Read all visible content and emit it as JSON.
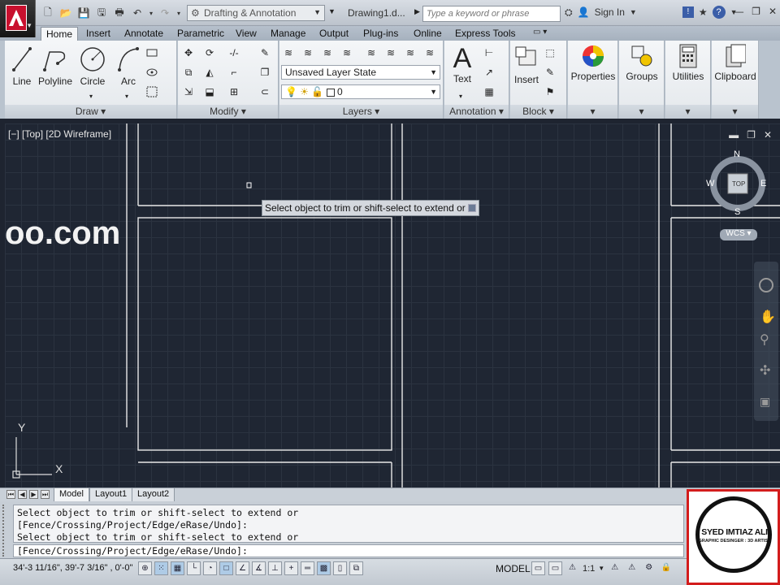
{
  "titlebar": {
    "workspace": "Drafting & Annotation",
    "document": "Drawing1.d...",
    "search_placeholder": "Type a keyword or phrase",
    "sign_in": "Sign In"
  },
  "tabs": [
    "Home",
    "Insert",
    "Annotate",
    "Parametric",
    "View",
    "Manage",
    "Output",
    "Plug-ins",
    "Online",
    "Express Tools"
  ],
  "ribbon": {
    "draw": {
      "title": "Draw",
      "tools": [
        "Line",
        "Polyline",
        "Circle",
        "Arc"
      ]
    },
    "modify": {
      "title": "Modify"
    },
    "layers": {
      "title": "Layers",
      "layer_state": "Unsaved Layer State",
      "current_layer": "0"
    },
    "annotation": {
      "title": "Annotation",
      "text_tool": "Text"
    },
    "block": {
      "title": "Block",
      "insert_tool": "Insert"
    },
    "properties": "Properties",
    "groups": "Groups",
    "utilities": "Utilities",
    "clipboard": "Clipboard"
  },
  "viewport": {
    "label": "[−] [Top] [2D Wireframe]",
    "tooltip": "Select object to trim or shift-select to extend or",
    "watermark": "oo.com",
    "compass": {
      "n": "N",
      "s": "S",
      "e": "E",
      "w": "W",
      "top": "TOP"
    },
    "wcs": "WCS",
    "ucs_x": "X",
    "ucs_y": "Y"
  },
  "layout_tabs": [
    "Model",
    "Layout1",
    "Layout2"
  ],
  "command": {
    "history": [
      "Select object to trim or shift-select to extend or",
      "[Fence/Crossing/Project/Edge/eRase/Undo]:",
      "Select object to trim or shift-select to extend or"
    ],
    "input": "[Fence/Crossing/Project/Edge/eRase/Undo]:"
  },
  "status": {
    "coords": "34'-3 11/16\", 39'-7 3/16\" , 0'-0\"",
    "model": "MODEL",
    "scale": "1:1"
  },
  "badge": {
    "name": "SYED IMTIAZ ALI",
    "subtitle": "GRAPHIC DESINGER : 3D ARTIST"
  }
}
